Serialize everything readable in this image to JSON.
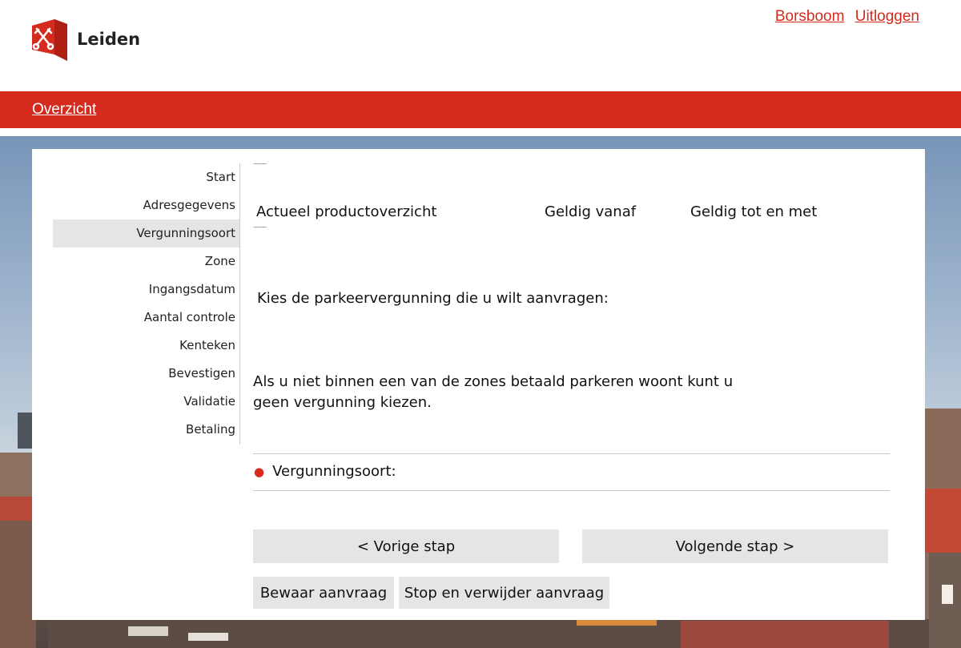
{
  "header": {
    "logo_text": "Leiden",
    "user_name": "Borsboom",
    "logout_label": "Uitloggen"
  },
  "nav": {
    "overview_label": "Overzicht"
  },
  "steps": [
    {
      "label": "Start",
      "active": false
    },
    {
      "label": "Adresgegevens",
      "active": false
    },
    {
      "label": "Vergunningsoort",
      "active": true
    },
    {
      "label": "Zone",
      "active": false
    },
    {
      "label": "Ingangsdatum",
      "active": false
    },
    {
      "label": "Aantal controle",
      "active": false
    },
    {
      "label": "Kenteken",
      "active": false
    },
    {
      "label": "Bevestigen",
      "active": false
    },
    {
      "label": "Validatie",
      "active": false
    },
    {
      "label": "Betaling",
      "active": false
    }
  ],
  "product_table": {
    "col_product": "Actueel productoverzicht",
    "col_valid_from": "Geldig vanaf",
    "col_valid_until": "Geldig tot en met"
  },
  "form": {
    "prompt": "Kies de parkeervergunning die u wilt aanvragen:",
    "note": "Als u niet binnen een van de zones  betaald parkeren woont kunt u geen vergunning  kiezen.",
    "field_label": "Vergunningsoort:"
  },
  "buttons": {
    "prev": "< Vorige stap",
    "next": "Volgende stap >",
    "save": "Bewaar aanvraag",
    "stop": "Stop en verwijder aanvraag"
  },
  "colors": {
    "brand_red": "#d42b1e",
    "active_step_bg": "#e5e5e5",
    "button_bg": "#e5e5e5"
  }
}
